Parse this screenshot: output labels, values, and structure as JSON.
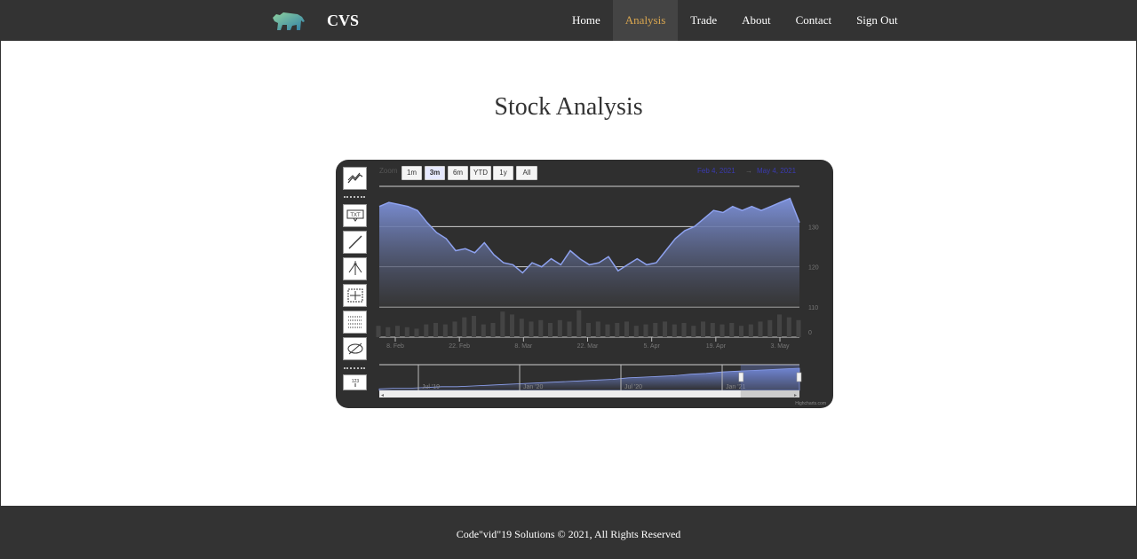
{
  "header": {
    "brand": "CVS",
    "logo_icon": "bear-icon",
    "nav": [
      {
        "label": "Home",
        "active": false
      },
      {
        "label": "Analysis",
        "active": true
      },
      {
        "label": "Trade",
        "active": false
      },
      {
        "label": "About",
        "active": false
      },
      {
        "label": "Contact",
        "active": false
      },
      {
        "label": "Sign Out",
        "active": false
      }
    ],
    "active_color": "#d9a650"
  },
  "page": {
    "title": "Stock Analysis"
  },
  "chart": {
    "zoom_label": "Zoom",
    "zoom_buttons": [
      "1m",
      "3m",
      "6m",
      "YTD",
      "1y",
      "All"
    ],
    "zoom_selected": "3m",
    "date_from": "Feb 4, 2021",
    "date_sep": "→",
    "date_to": "May 4, 2021",
    "credits": "Highcharts.com",
    "tools": [
      "line-series-icon",
      "text-annotation-icon",
      "line-draw-icon",
      "pitchfork-icon",
      "measure-icon",
      "fibonacci-icon",
      "hide-icon",
      "indicator-icon"
    ]
  },
  "chart_data": {
    "type": "area",
    "x": [
      "Feb 4",
      "Feb 6",
      "Feb 8",
      "Feb 10",
      "Feb 12",
      "Feb 14",
      "Feb 16",
      "Feb 18",
      "Feb 20",
      "Feb 22",
      "Feb 24",
      "Feb 26",
      "Feb 28",
      "Mar 2",
      "Mar 4",
      "Mar 6",
      "Mar 8",
      "Mar 10",
      "Mar 12",
      "Mar 14",
      "Mar 16",
      "Mar 18",
      "Mar 20",
      "Mar 22",
      "Mar 24",
      "Mar 26",
      "Mar 28",
      "Mar 30",
      "Apr 1",
      "Apr 3",
      "Apr 5",
      "Apr 7",
      "Apr 9",
      "Apr 11",
      "Apr 13",
      "Apr 15",
      "Apr 17",
      "Apr 19",
      "Apr 21",
      "Apr 23",
      "Apr 25",
      "Apr 27",
      "Apr 29",
      "May 1",
      "May 4"
    ],
    "series": [
      {
        "values": [
          135,
          136,
          135.5,
          135,
          134,
          131,
          128.5,
          127,
          124,
          124.5,
          123.5,
          126,
          123,
          121,
          120.5,
          118.5,
          121,
          120,
          122,
          120.5,
          124,
          122,
          120.5,
          121,
          122.5,
          119,
          120.5,
          122,
          120.5,
          121,
          124,
          127,
          129,
          130,
          132,
          134,
          133.5,
          135,
          134,
          135,
          134,
          135,
          136,
          137,
          131
        ]
      },
      {
        "values": [
          8,
          7,
          8,
          7,
          6,
          9,
          10,
          9,
          11,
          14,
          15,
          9,
          10,
          18,
          16,
          13,
          11,
          12,
          10,
          12,
          11,
          19,
          10,
          11,
          9,
          10,
          11,
          8,
          9,
          10,
          11,
          9,
          10,
          8,
          11,
          10,
          9,
          10,
          8,
          9,
          11,
          12,
          16,
          14,
          12
        ]
      }
    ],
    "x_ticks": [
      "8. Feb",
      "22. Feb",
      "8. Mar",
      "22. Mar",
      "5. Apr",
      "19. Apr",
      "3. May"
    ],
    "y_ticks": [
      "130",
      "120",
      "110",
      "0"
    ],
    "ylim": [
      110,
      140
    ],
    "navigator_ticks": [
      "Jul '19",
      "Jan '20",
      "Jul '20",
      "Jan '21"
    ],
    "navigator_values": [
      2,
      3,
      3,
      4,
      5,
      5,
      6,
      7,
      8,
      9,
      10,
      11,
      12,
      13,
      14,
      15,
      17,
      18,
      19,
      20,
      22,
      23,
      25,
      26,
      27,
      28,
      29,
      30
    ],
    "navigator_selection": [
      0.86,
      1.0
    ],
    "grid": true,
    "colors": {
      "area_top": "#7b8fd6",
      "area_bottom": "#3a3a3a",
      "line": "#8ea2ef"
    }
  },
  "footer": {
    "text": "Code\"vid\"19 Solutions © 2021, All Rights Reserved"
  }
}
